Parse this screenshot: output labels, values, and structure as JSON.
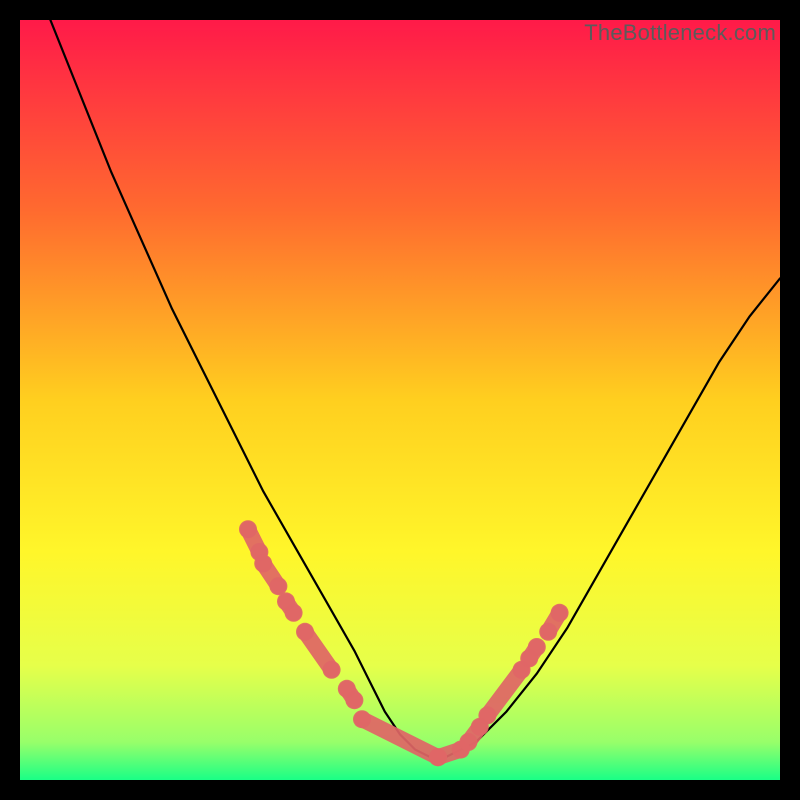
{
  "watermark": "TheBottleneck.com",
  "gradient": {
    "stops": [
      {
        "offset": 0.0,
        "color": "#ff1a49"
      },
      {
        "offset": 0.25,
        "color": "#ff6a2f"
      },
      {
        "offset": 0.5,
        "color": "#ffcf1f"
      },
      {
        "offset": 0.7,
        "color": "#fff62a"
      },
      {
        "offset": 0.85,
        "color": "#e6ff4a"
      },
      {
        "offset": 0.95,
        "color": "#98ff6a"
      },
      {
        "offset": 1.0,
        "color": "#1aff86"
      }
    ]
  },
  "chart_data": {
    "type": "line",
    "title": "",
    "xlabel": "",
    "ylabel": "",
    "xlim": [
      0,
      100
    ],
    "ylim": [
      0,
      100
    ],
    "series": [
      {
        "name": "bottleneck-curve",
        "x": [
          4,
          8,
          12,
          16,
          20,
          24,
          28,
          32,
          36,
          40,
          44,
          46,
          48,
          50,
          52,
          54,
          56,
          60,
          64,
          68,
          72,
          76,
          80,
          84,
          88,
          92,
          96,
          100
        ],
        "y": [
          100,
          90,
          80,
          71,
          62,
          54,
          46,
          38,
          31,
          24,
          17,
          13,
          9,
          6,
          4,
          3,
          3,
          5,
          9,
          14,
          20,
          27,
          34,
          41,
          48,
          55,
          61,
          66
        ]
      }
    ],
    "highlight_segments": [
      {
        "x": [
          30,
          31.5
        ],
        "y": [
          33,
          30
        ]
      },
      {
        "x": [
          32,
          34
        ],
        "y": [
          28.5,
          25.5
        ]
      },
      {
        "x": [
          35,
          36
        ],
        "y": [
          23.5,
          22
        ]
      },
      {
        "x": [
          37.5,
          41
        ],
        "y": [
          19.5,
          14.5
        ]
      },
      {
        "x": [
          43,
          44
        ],
        "y": [
          12,
          10.5
        ]
      },
      {
        "x": [
          45,
          55
        ],
        "y": [
          8,
          3
        ]
      },
      {
        "x": [
          55,
          58
        ],
        "y": [
          3,
          4
        ]
      },
      {
        "x": [
          59,
          60.5
        ],
        "y": [
          5,
          7
        ]
      },
      {
        "x": [
          61.5,
          66
        ],
        "y": [
          8.5,
          14.5
        ]
      },
      {
        "x": [
          67,
          68
        ],
        "y": [
          16,
          17.5
        ]
      },
      {
        "x": [
          69.5,
          71
        ],
        "y": [
          19.5,
          22
        ]
      }
    ],
    "highlight_color": "#e06666"
  }
}
